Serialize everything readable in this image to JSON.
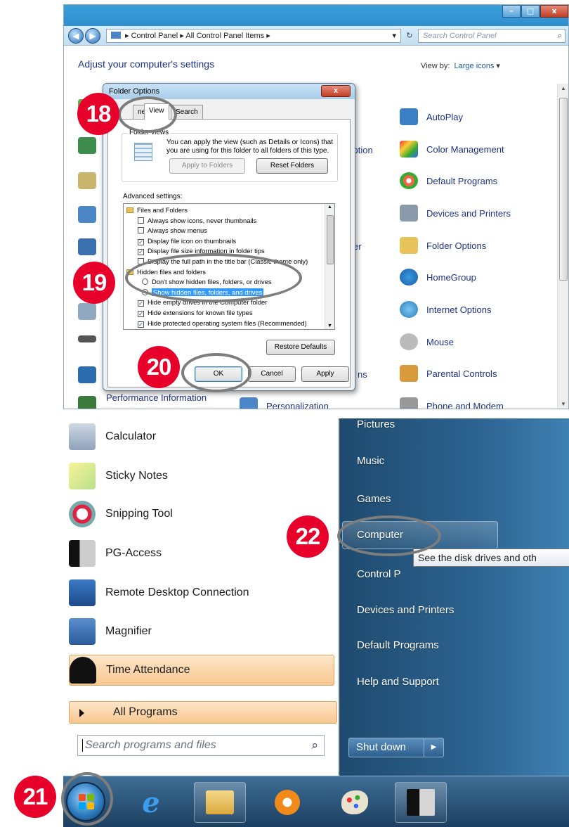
{
  "control_panel": {
    "address_crumbs": [
      "Control Panel",
      "All Control Panel Items"
    ],
    "search_placeholder": "Search Control Panel",
    "header": "Adjust your computer's settings",
    "view_by_label": "View by:",
    "view_by_value": "Large icons",
    "window_buttons": [
      "–",
      "□",
      "x"
    ],
    "partial_middle": [
      "yption",
      "er",
      "ns"
    ],
    "right_items": [
      "AutoPlay",
      "Color Management",
      "Default Programs",
      "Devices and Printers",
      "Folder Options",
      "HomeGroup",
      "Internet Options",
      "Mouse",
      "Parental Controls",
      "Phone and Modem"
    ],
    "bottom_items": [
      "Performance Information",
      "Personalization"
    ]
  },
  "folder_options": {
    "title": "Folder Options",
    "close": "x",
    "tabs": [
      "neral",
      "View",
      "Search"
    ],
    "folder_views_label": "Folder views",
    "folder_views_text": "You can apply the view (such as Details or Icons) that you are using for this folder to all folders of this type.",
    "apply_to_folders": "Apply to Folders",
    "reset_folders": "Reset Folders",
    "advanced_label": "Advanced settings:",
    "tree": [
      {
        "kind": "folder",
        "text": "Files and Folders"
      },
      {
        "kind": "check",
        "checked": false,
        "text": "Always show icons, never thumbnails"
      },
      {
        "kind": "check",
        "checked": false,
        "text": "Always show menus"
      },
      {
        "kind": "check",
        "checked": true,
        "text": "Display file icon on thumbnails"
      },
      {
        "kind": "check",
        "checked": true,
        "text": "Display file size information in folder tips"
      },
      {
        "kind": "check",
        "checked": false,
        "text": "Display the full path in the title bar (Classic theme only)"
      },
      {
        "kind": "folder",
        "text": "Hidden files and folders"
      },
      {
        "kind": "radio",
        "checked": false,
        "text": "Don't show hidden files, folders, or drives"
      },
      {
        "kind": "radio",
        "checked": true,
        "text": "Show hidden files, folders, and drives"
      },
      {
        "kind": "check",
        "checked": true,
        "text": "Hide empty drives in the Computer folder"
      },
      {
        "kind": "check",
        "checked": true,
        "text": "Hide extensions for known file types"
      },
      {
        "kind": "check",
        "checked": true,
        "text": "Hide protected operating system files (Recommended)"
      }
    ],
    "restore_defaults": "Restore Defaults",
    "ok": "OK",
    "cancel": "Cancel",
    "apply": "Apply"
  },
  "start_menu": {
    "programs": [
      "Calculator",
      "Sticky Notes",
      "Snipping Tool",
      "PG-Access",
      "Remote Desktop Connection",
      "Magnifier",
      "Time Attendance"
    ],
    "all_programs": "All Programs",
    "search_placeholder": "Search programs and files",
    "right_items": [
      "Pictures",
      "Music",
      "Games",
      "Computer",
      "Control P",
      "Devices and Printers",
      "Default Programs",
      "Help and Support"
    ],
    "tooltip": "See the disk drives and oth",
    "shut_down": "Shut down"
  },
  "steps": [
    "18",
    "19",
    "20",
    "21",
    "22"
  ],
  "colors": {
    "step_badge": "#e7002a",
    "ring": "#7d7d7d",
    "link_blue": "#1e3287",
    "selection": "#3399ff"
  }
}
